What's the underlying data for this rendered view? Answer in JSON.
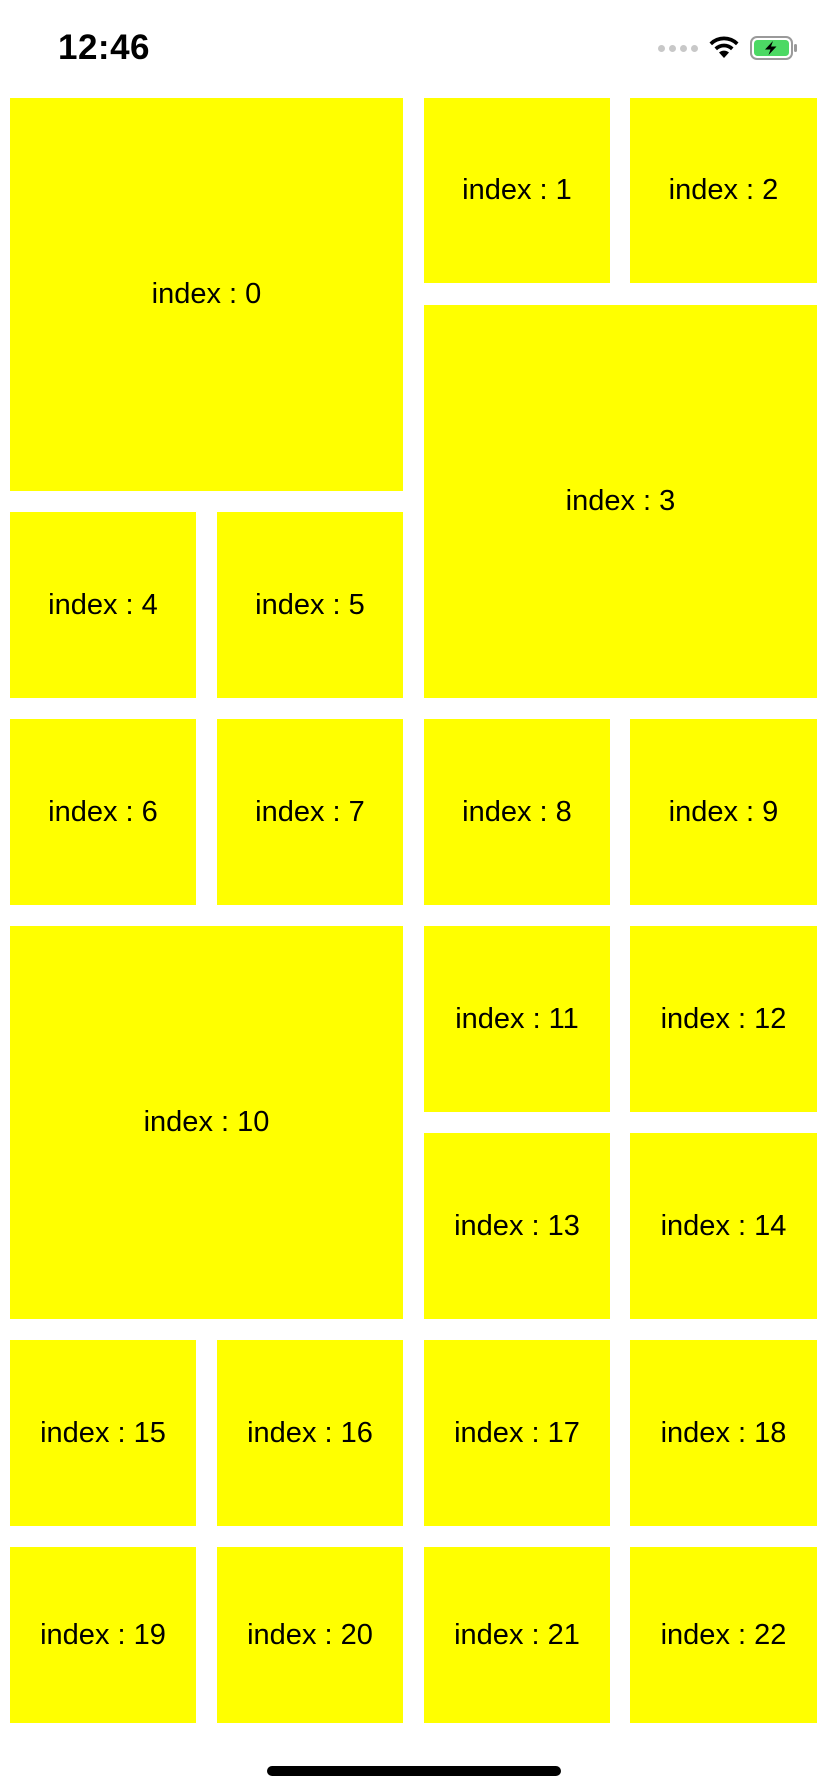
{
  "status_bar": {
    "time": "12:46",
    "icons": [
      "signal-icon",
      "wifi-icon",
      "battery-charging-icon"
    ],
    "battery_color": "#4cd964"
  },
  "colors": {
    "cell_background": "#ffff00",
    "page_background": "#ffffff",
    "text": "#000000"
  },
  "cells": [
    {
      "label": "index : 0"
    },
    {
      "label": "index : 1"
    },
    {
      "label": "index : 2"
    },
    {
      "label": "index : 3"
    },
    {
      "label": "index : 4"
    },
    {
      "label": "index : 5"
    },
    {
      "label": "index : 6"
    },
    {
      "label": "index : 7"
    },
    {
      "label": "index : 8"
    },
    {
      "label": "index : 9"
    },
    {
      "label": "index : 10"
    },
    {
      "label": "index : 11"
    },
    {
      "label": "index : 12"
    },
    {
      "label": "index : 13"
    },
    {
      "label": "index : 14"
    },
    {
      "label": "index : 15"
    },
    {
      "label": "index : 16"
    },
    {
      "label": "index : 17"
    },
    {
      "label": "index : 18"
    },
    {
      "label": "index : 19"
    },
    {
      "label": "index : 20"
    },
    {
      "label": "index : 21"
    },
    {
      "label": "index : 22"
    }
  ]
}
